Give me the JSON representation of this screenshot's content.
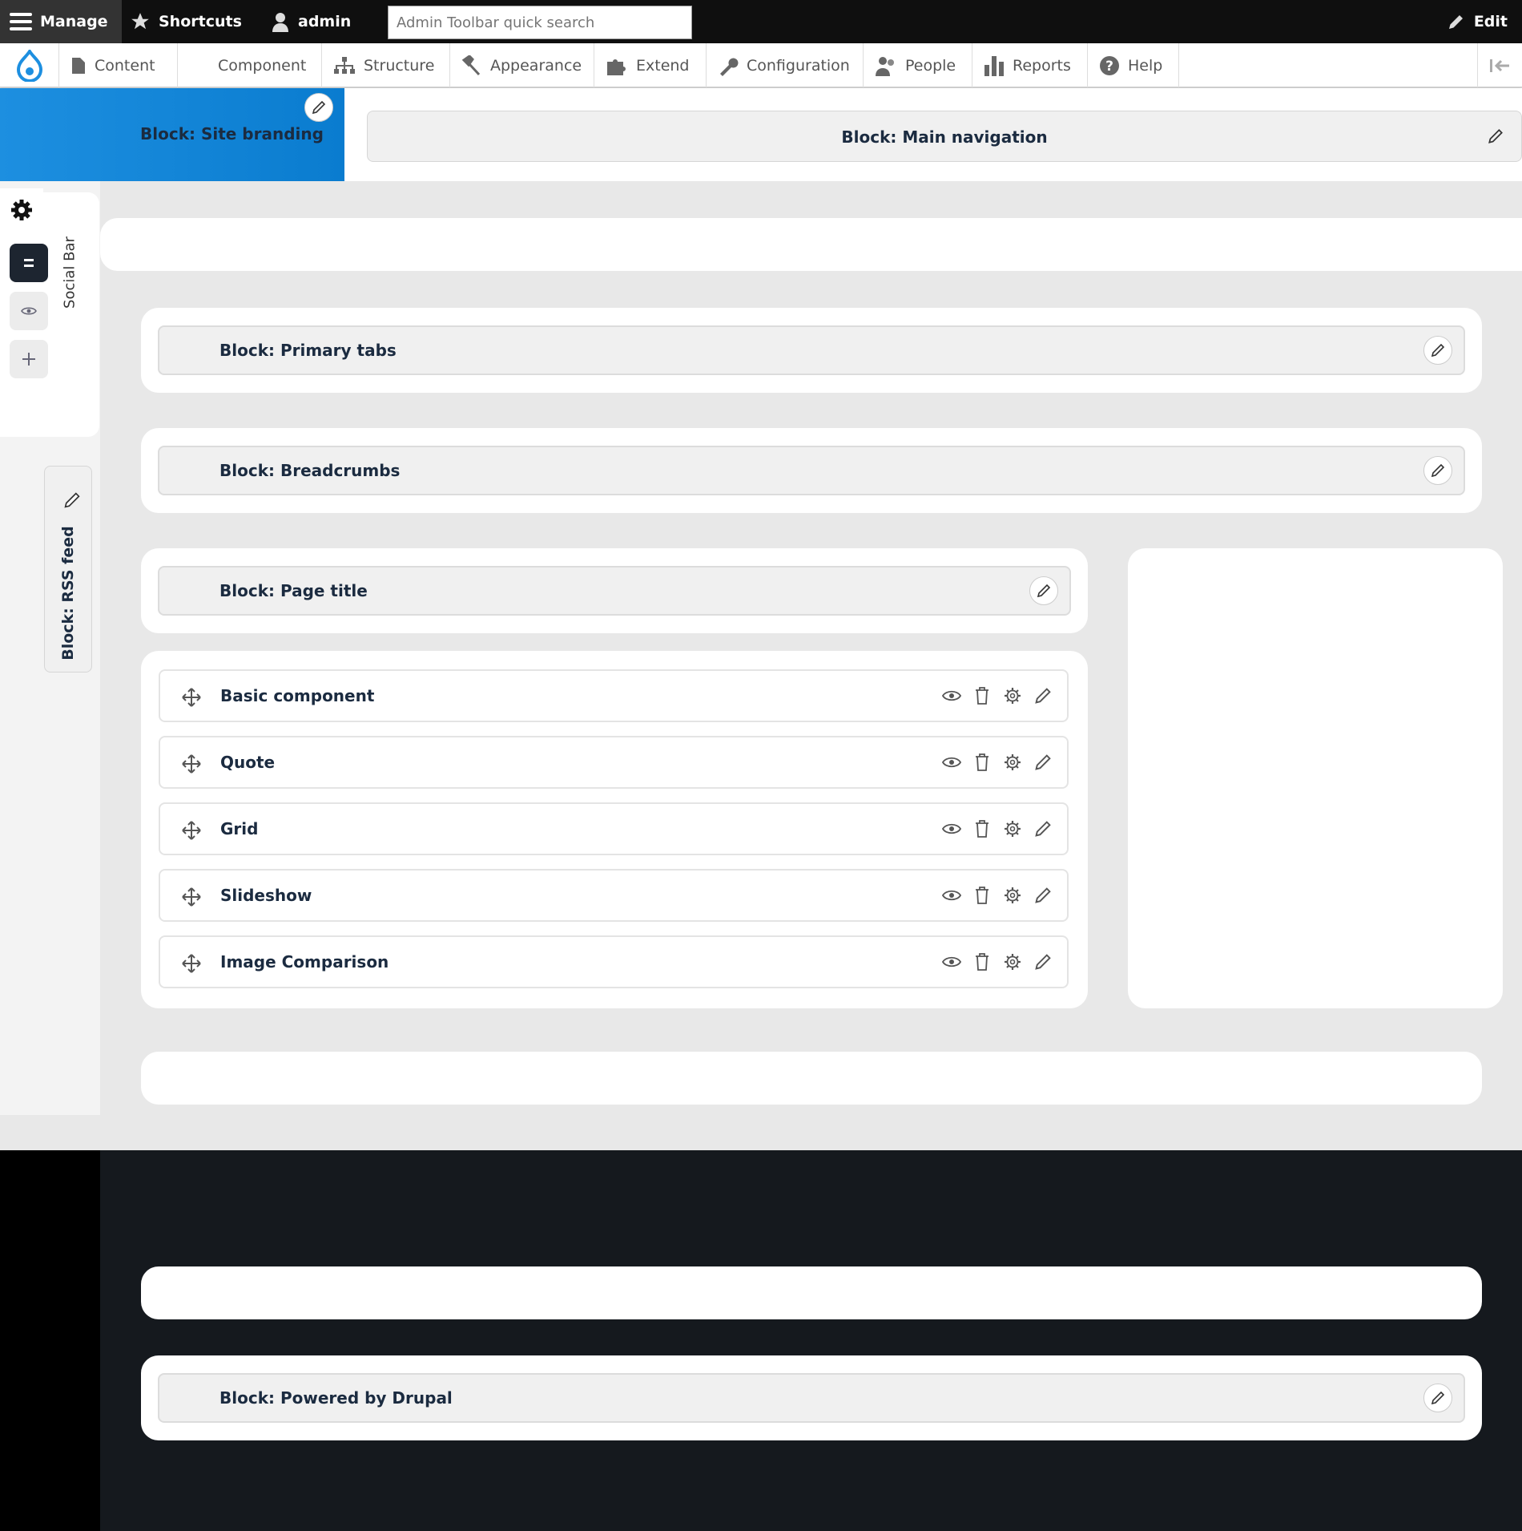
{
  "toolbar": {
    "manage": "Manage",
    "shortcuts": "Shortcuts",
    "user": "admin",
    "search_placeholder": "Admin Toolbar quick search",
    "edit": "Edit"
  },
  "tray": {
    "items": [
      {
        "label": "Content",
        "icon": "file-icon"
      },
      {
        "label": "Component",
        "icon": "none"
      },
      {
        "label": "Structure",
        "icon": "sitemap-icon"
      },
      {
        "label": "Appearance",
        "icon": "brush-icon"
      },
      {
        "label": "Extend",
        "icon": "puzzle-icon"
      },
      {
        "label": "Configuration",
        "icon": "wrench-icon"
      },
      {
        "label": "People",
        "icon": "people-icon"
      },
      {
        "label": "Reports",
        "icon": "bar-chart-icon"
      },
      {
        "label": "Help",
        "icon": "question-icon"
      }
    ]
  },
  "header": {
    "branding": "Block: Site branding",
    "main_nav": "Block: Main navigation"
  },
  "sidebar": {
    "region_label": "Social Bar",
    "rss_block": "Block: RSS feed"
  },
  "blocks": {
    "primary_tabs": "Block: Primary tabs",
    "breadcrumbs": "Block: Breadcrumbs",
    "page_title": "Block: Page title",
    "powered_by": "Block: Powered by Drupal"
  },
  "components": [
    {
      "label": "Basic component"
    },
    {
      "label": "Quote"
    },
    {
      "label": "Grid"
    },
    {
      "label": "Slideshow"
    },
    {
      "label": "Image Comparison"
    }
  ],
  "colors": {
    "brand_blue": "#0a7ccf",
    "toolbar_bg": "#0f0f0f",
    "footer_bg": "#15191e"
  }
}
